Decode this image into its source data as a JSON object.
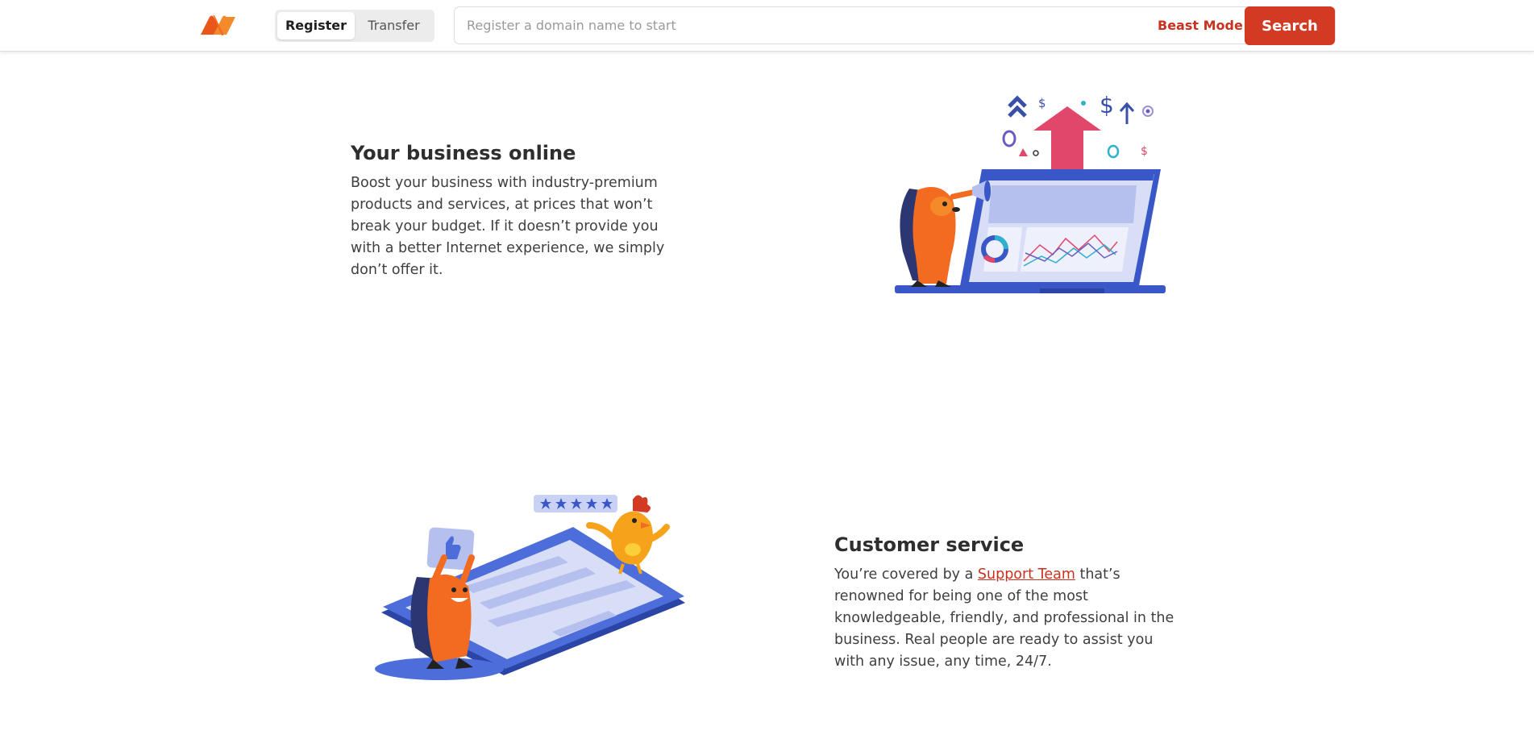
{
  "header": {
    "logo_icon": "namecheap-logo-icon",
    "tabs": [
      {
        "label": "Register",
        "active": true
      },
      {
        "label": "Transfer",
        "active": false
      }
    ],
    "search": {
      "placeholder": "Register a domain name to start",
      "value": ""
    },
    "beast_mode_label": "Beast Mode",
    "search_button_label": "Search",
    "colors": {
      "accent": "#d23a23",
      "link": "#c8321f",
      "logo_orange": "#f26b21"
    }
  },
  "features": [
    {
      "title": "Your business online",
      "body": "Boost your business with industry-premium products and services, at prices that won’t break your budget. If it doesn’t provide you with a better Internet experience, we simply don’t offer it.",
      "illustration": "hedgehog-laptop-growth-illustration"
    },
    {
      "title": "Customer service",
      "body_before": "You’re covered by a ",
      "link_label": "Support Team",
      "body_after": " that’s renowned for being one of the most knowledgeable, friendly, and professional in the business. Real people are ready to assist you with any issue, any time, 24/7.",
      "illustration": "hedgehog-rooster-review-illustration",
      "rating_stars": 5
    }
  ],
  "illustration_labels": {
    "dollar": "$"
  }
}
